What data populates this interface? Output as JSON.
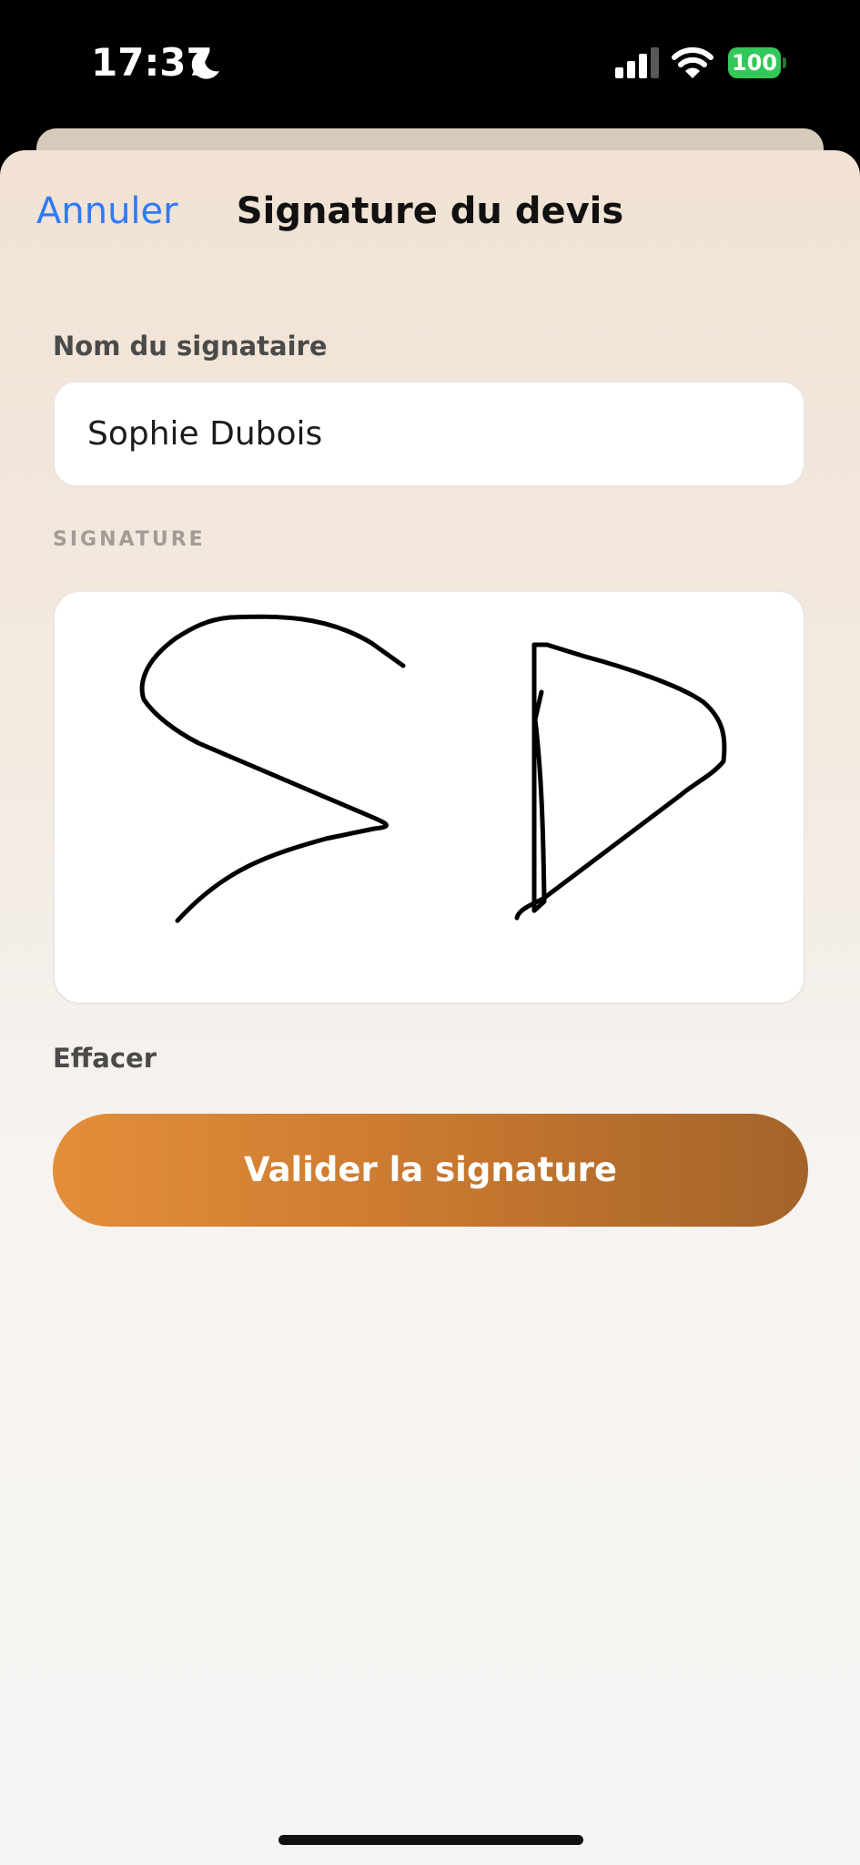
{
  "status_bar": {
    "time": "17:37",
    "battery_level": "100",
    "icons": [
      "moon-icon",
      "signal-icon",
      "wifi-icon",
      "battery-icon"
    ]
  },
  "nav": {
    "cancel_label": "Annuler",
    "title": "Signature du devis"
  },
  "form": {
    "name_label": "Nom du signataire",
    "name_value": "Sophie Dubois",
    "signature_label": "SIGNATURE",
    "signature_drawn": true,
    "clear_label": "Effacer",
    "submit_label": "Valider la signature"
  },
  "colors": {
    "accent_link": "#2f7bf6",
    "button_start": "#e38e3a",
    "button_end": "#a4632a",
    "battery": "#34c759"
  }
}
